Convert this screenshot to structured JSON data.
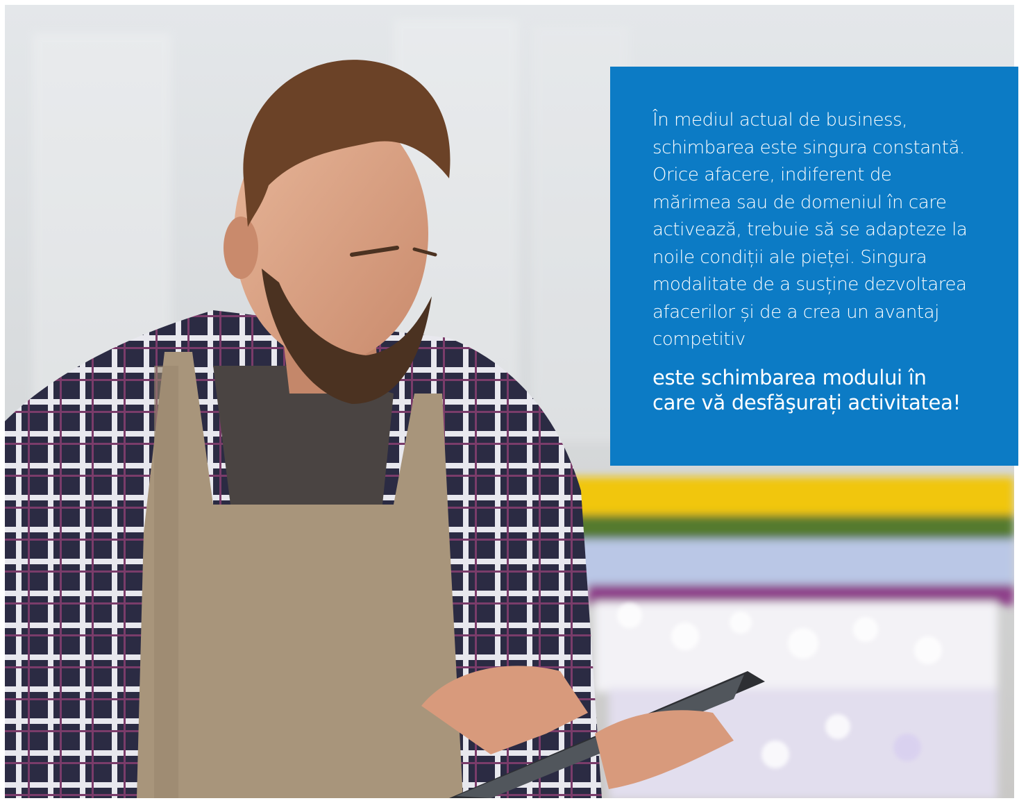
{
  "photo": {
    "subject": "bearded man in plaid shirt and apron using a tablet in a greenhouse",
    "icon": "photo-icon"
  },
  "panel": {
    "background_color": "#0c7bc5",
    "text_color": "#ffffff",
    "body_text": "În mediul actual de business,\nschimbarea este singura constantă.\nOrice afacere, indiferent de\nmărimea sau de domeniul în care\nactivează, trebuie să se adapteze la\nnoile condiții ale pieței. Singura\nmodalitate de a susține dezvoltarea\nafacerilor și de a crea un avantaj\ncompetitiv",
    "emphasis_text": "este schimbarea modului în\ncare vă desfăşurați activitatea!"
  }
}
